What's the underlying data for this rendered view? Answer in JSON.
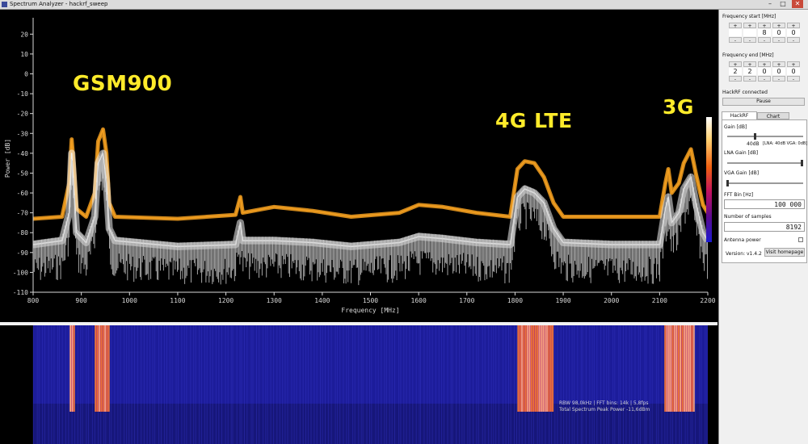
{
  "window": {
    "title": "Spectrum Analyzer - hackrf_sweep",
    "minimize": "–",
    "maximize": "□",
    "close": "✕"
  },
  "overlay_labels": {
    "gsm": "GSM900",
    "lte": "4G LTE",
    "g3": "3G"
  },
  "chart_data": {
    "type": "line",
    "title": "",
    "xlabel": "Frequency [MHz]",
    "ylabel": "Power [dB]",
    "xlim": [
      800,
      2200
    ],
    "ylim": [
      -110,
      25
    ],
    "x_ticks": [
      "800",
      "900",
      "1000",
      "1100",
      "1200",
      "1300",
      "1400",
      "1500",
      "1600",
      "1700",
      "1800",
      "1900",
      "2000",
      "2100",
      "2200"
    ],
    "y_ticks": [
      "20",
      "10",
      "0",
      "-10",
      "-20",
      "-30",
      "-40",
      "-50",
      "-60",
      "-70",
      "-80",
      "-90",
      "-100",
      "-110"
    ],
    "grid": false,
    "series": [
      {
        "color": "#f5a020",
        "points": [
          [
            800,
            -73
          ],
          [
            860,
            -72
          ],
          [
            875,
            -55
          ],
          [
            880,
            -33
          ],
          [
            885,
            -48
          ],
          [
            890,
            -68
          ],
          [
            910,
            -72
          ],
          [
            928,
            -60
          ],
          [
            935,
            -34
          ],
          [
            945,
            -28
          ],
          [
            952,
            -40
          ],
          [
            958,
            -65
          ],
          [
            970,
            -72
          ],
          [
            1100,
            -73
          ],
          [
            1220,
            -71
          ],
          [
            1230,
            -62
          ],
          [
            1235,
            -70
          ],
          [
            1300,
            -67
          ],
          [
            1380,
            -69
          ],
          [
            1460,
            -72
          ],
          [
            1560,
            -70
          ],
          [
            1600,
            -66
          ],
          [
            1650,
            -67
          ],
          [
            1720,
            -70
          ],
          [
            1790,
            -72
          ],
          [
            1805,
            -48
          ],
          [
            1820,
            -44
          ],
          [
            1840,
            -45
          ],
          [
            1860,
            -52
          ],
          [
            1880,
            -65
          ],
          [
            1900,
            -72
          ],
          [
            2000,
            -72
          ],
          [
            2100,
            -72
          ],
          [
            2112,
            -55
          ],
          [
            2118,
            -48
          ],
          [
            2125,
            -60
          ],
          [
            2140,
            -55
          ],
          [
            2150,
            -45
          ],
          [
            2165,
            -38
          ],
          [
            2175,
            -50
          ],
          [
            2190,
            -66
          ],
          [
            2200,
            -70
          ]
        ]
      },
      {
        "color": "#f0f0f0",
        "points": [
          [
            800,
            -86
          ],
          [
            860,
            -84
          ],
          [
            875,
            -70
          ],
          [
            880,
            -40
          ],
          [
            885,
            -60
          ],
          [
            890,
            -80
          ],
          [
            910,
            -85
          ],
          [
            928,
            -72
          ],
          [
            935,
            -45
          ],
          [
            945,
            -40
          ],
          [
            952,
            -55
          ],
          [
            958,
            -78
          ],
          [
            970,
            -84
          ],
          [
            1100,
            -87
          ],
          [
            1220,
            -86
          ],
          [
            1230,
            -75
          ],
          [
            1235,
            -84
          ],
          [
            1300,
            -84
          ],
          [
            1380,
            -85
          ],
          [
            1460,
            -87
          ],
          [
            1560,
            -85
          ],
          [
            1600,
            -82
          ],
          [
            1650,
            -83
          ],
          [
            1720,
            -85
          ],
          [
            1790,
            -86
          ],
          [
            1805,
            -62
          ],
          [
            1820,
            -58
          ],
          [
            1840,
            -60
          ],
          [
            1860,
            -65
          ],
          [
            1880,
            -78
          ],
          [
            1900,
            -85
          ],
          [
            2000,
            -86
          ],
          [
            2100,
            -86
          ],
          [
            2112,
            -68
          ],
          [
            2118,
            -62
          ],
          [
            2125,
            -75
          ],
          [
            2140,
            -70
          ],
          [
            2150,
            -58
          ],
          [
            2165,
            -52
          ],
          [
            2175,
            -65
          ],
          [
            2190,
            -80
          ],
          [
            2200,
            -84
          ]
        ]
      }
    ]
  },
  "waterfall": {
    "bands_mhz": [
      [
        876,
        885
      ],
      [
        928,
        958
      ],
      [
        1805,
        1880
      ],
      [
        2110,
        2170
      ]
    ]
  },
  "status": {
    "line1": "RBW 98,0kHz | FFT bins: 14k | 5,8fps",
    "line2": "Total Spectrum Peak Power -11,6dBm"
  },
  "panel": {
    "freq_start_label": "Frequency start [MHz]",
    "freq_start_digits": [
      "",
      "",
      "8",
      "0",
      "0"
    ],
    "freq_end_label": "Frequency end [MHz]",
    "freq_end_digits": [
      "2",
      "2",
      "0",
      "0",
      "0"
    ],
    "plus": "+",
    "minus": "-",
    "connected": "HackRF connected",
    "pause": "Pause",
    "tabs": [
      "HackRF Settings",
      "Chart options"
    ],
    "gain_label": "Gain [dB]",
    "gain_value": "40dB",
    "gain_details": "[LNA: 40dB  VGA: 0dB]",
    "lna_label": "LNA Gain [dB]",
    "vga_label": "VGA Gain [dB]",
    "fft_label": "FFT Bin [Hz]",
    "fft_value": "100 000",
    "samples_label": "Number of samples",
    "samples_value": "8192",
    "antenna_label": "Antenna power",
    "version": "Version: v1.4.2",
    "homepage": "Visit homepage"
  },
  "colors": {
    "orange": "#f5a020",
    "white": "#f0f0f0",
    "label": "#ffeb2a",
    "waterfall_bg": "#1c1c9a"
  }
}
